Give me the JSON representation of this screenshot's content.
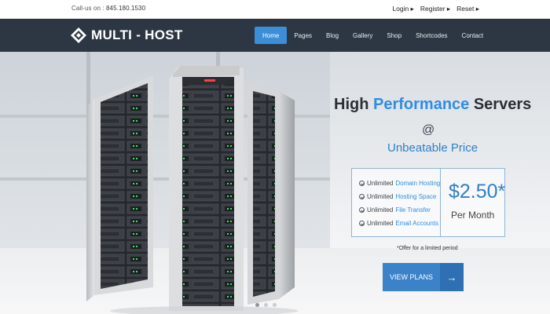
{
  "topbar": {
    "call_label": "Call-us on :",
    "call_number": "845.180.1530",
    "links": [
      "Login ▸",
      "Register ▸",
      "Reset ▸"
    ]
  },
  "navbar": {
    "logo_text": "MULTI - HOST",
    "items": [
      "Home",
      "Pages",
      "Blog",
      "Gallery",
      "Shop",
      "Shortcodes",
      "Contact"
    ],
    "active_item": "Home"
  },
  "hero": {
    "title_prefix": "High ",
    "title_highlight": "Performance",
    "title_suffix": " Servers",
    "at": "@",
    "subtitle": "Unbeatable Price",
    "features": [
      {
        "prefix": "Unlimited ",
        "highlight": "Domain Hosting"
      },
      {
        "prefix": "Unlimited ",
        "highlight": "Hosting Space"
      },
      {
        "prefix": "Unlimited ",
        "highlight": "File Transfer"
      },
      {
        "prefix": "Unlimited ",
        "highlight": "Email Accounts"
      }
    ],
    "price": "$2.50*",
    "per": "Per Month",
    "offer_note": "*Offer for a limited period",
    "cta_label": "VIEW PLANS",
    "cta_arrow": "→"
  },
  "colors": {
    "navbar_bg": "#2d3744",
    "accent": "#2f8de4",
    "cta": "#3b82c9"
  },
  "slider": {
    "count": 3,
    "active_index": 0
  }
}
